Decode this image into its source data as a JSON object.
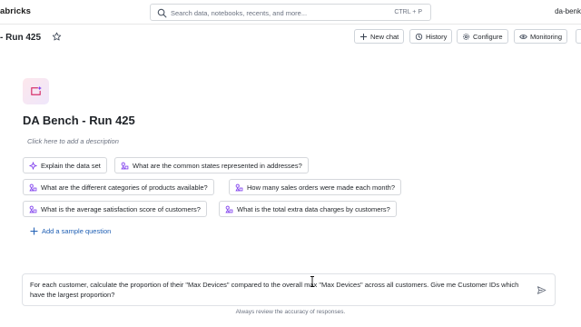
{
  "topbar": {
    "brand": "abricks",
    "search_placeholder": "Search data, notebooks, recents, and more...",
    "shortcut": "CTRL + P",
    "workspace": "da-benk"
  },
  "header": {
    "title": "- Run 425",
    "buttons": {
      "new_chat": "New chat",
      "history": "History",
      "configure": "Configure",
      "monitoring": "Monitoring"
    }
  },
  "space": {
    "title": "DA Bench - Run 425",
    "description_placeholder": "Click here to add a description",
    "sample_questions": [
      "Explain the data set",
      "What are the common states represented in addresses?",
      "What are the different categories of products available?",
      "How many sales orders were made each month?",
      "What is the average satisfaction score of customers?",
      "What is the total extra data charges by customers?"
    ],
    "add_sample_label": "Add a sample question"
  },
  "prompt": {
    "text": "For each customer, calculate the proportion of their \"Max Devices\" compared to the overall max \"Max Devices\" across all customers. Give me Customer IDs which have the largest proportion?"
  },
  "footer": {
    "note": "Always review the accuracy of responses."
  },
  "colors": {
    "accent_link": "#1f5fb4",
    "chip_icon": "#7c3aed",
    "logo_icon": "#d6336c"
  }
}
